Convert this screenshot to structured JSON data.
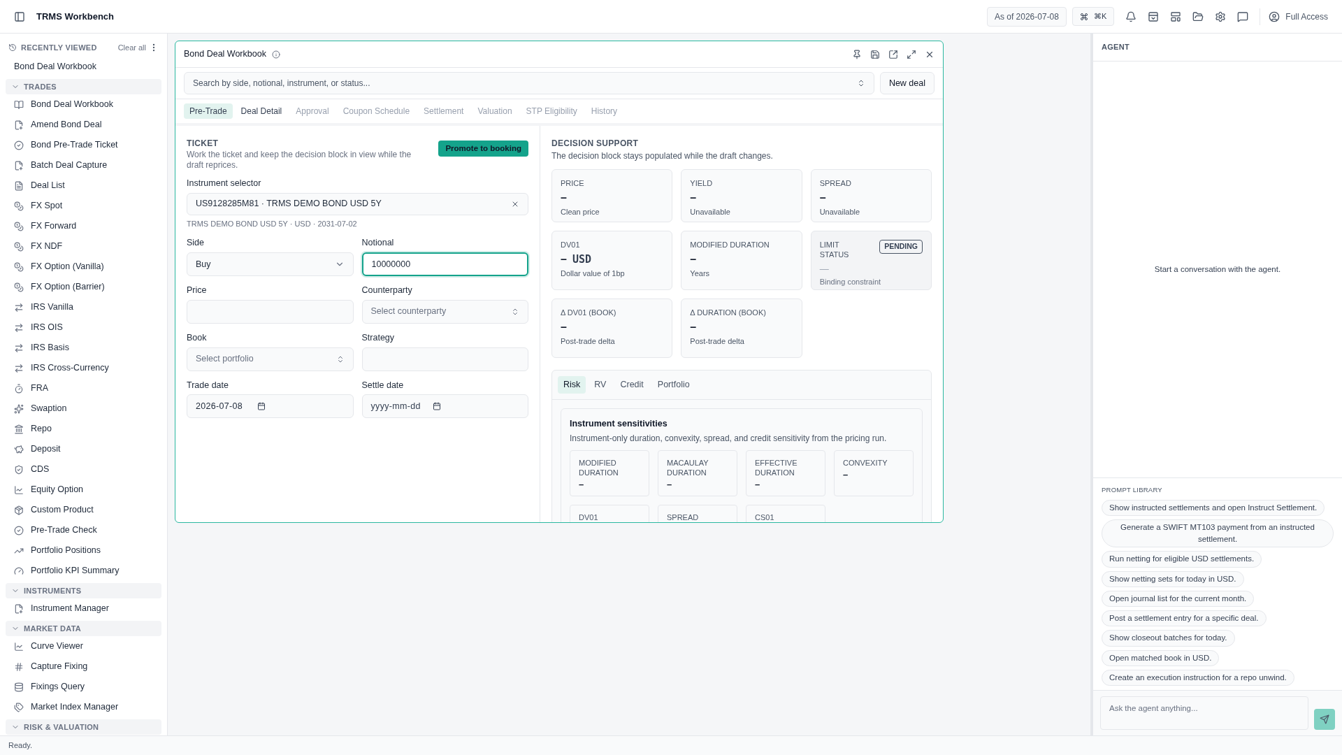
{
  "app": {
    "title": "TRMS Workbench",
    "as_of": "As of 2026-07-08",
    "shortcut": "⌘K",
    "access": "Full Access"
  },
  "sidebar": {
    "recent_title": "RECENTLY VIEWED",
    "clear": "Clear all",
    "recent": [
      "Bond Deal Workbook"
    ],
    "sections": [
      {
        "title": "TRADES",
        "expanded": true,
        "items": [
          "Bond Deal Workbook",
          "Amend Bond Deal",
          "Bond Pre-Trade Ticket",
          "Batch Deal Capture",
          "Deal List",
          "FX Spot",
          "FX Forward",
          "FX NDF",
          "FX Option (Vanilla)",
          "FX Option (Barrier)",
          "IRS Vanilla",
          "IRS OIS",
          "IRS Basis",
          "IRS Cross-Currency",
          "FRA",
          "Swaption",
          "Repo",
          "Deposit",
          "CDS",
          "Equity Option",
          "Custom Product",
          "Pre-Trade Check",
          "Portfolio Positions",
          "Portfolio KPI Summary"
        ]
      },
      {
        "title": "INSTRUMENTS",
        "expanded": true,
        "items": [
          "Instrument Manager"
        ]
      },
      {
        "title": "MARKET DATA",
        "expanded": true,
        "items": [
          "Curve Viewer",
          "Capture Fixing",
          "Fixings Query",
          "Market Index Manager"
        ]
      },
      {
        "title": "RISK & VALUATION",
        "expanded": true
      }
    ]
  },
  "window": {
    "title": "Bond Deal Workbook",
    "search_placeholder": "Search by side, notional, instrument, or status...",
    "new_button": "New deal",
    "tabs": [
      {
        "label": "Pre-Trade",
        "selected": true,
        "disabled": false
      },
      {
        "label": "Deal Detail",
        "selected": false,
        "disabled": false
      },
      {
        "label": "Approval",
        "selected": false,
        "disabled": true
      },
      {
        "label": "Coupon Schedule",
        "selected": false,
        "disabled": true
      },
      {
        "label": "Settlement",
        "selected": false,
        "disabled": true
      },
      {
        "label": "Valuation",
        "selected": false,
        "disabled": true
      },
      {
        "label": "STP Eligibility",
        "selected": false,
        "disabled": true
      },
      {
        "label": "History",
        "selected": false,
        "disabled": true
      }
    ]
  },
  "ticket": {
    "title": "TICKET",
    "description": "Work the ticket and keep the decision block in view while the draft reprices.",
    "promote_button": "Promote to booking",
    "instrument_label": "Instrument selector",
    "instrument_value": "US9128285M81 · TRMS DEMO BOND USD 5Y",
    "instrument_detail": "TRMS DEMO BOND USD 5Y · USD · 2031-07-02",
    "fields": [
      {
        "label": "Side",
        "kind": "select",
        "value": "Buy",
        "focused": false
      },
      {
        "label": "Notional",
        "kind": "input",
        "value": "10000000",
        "focused": true
      },
      {
        "label": "Price",
        "kind": "input",
        "focused": false
      },
      {
        "label": "Counterparty",
        "kind": "combo",
        "placeholder": "Select counterparty",
        "focused": false
      },
      {
        "label": "Book",
        "kind": "combo",
        "placeholder": "Select portfolio",
        "focused": false
      },
      {
        "label": "Strategy",
        "kind": "input",
        "focused": false
      },
      {
        "label": "Trade date",
        "kind": "date",
        "value": "2026-07-08",
        "focused": false
      },
      {
        "label": "Settle date",
        "kind": "date",
        "placeholder": "yyyy-mm-dd",
        "focused": false
      }
    ]
  },
  "decision": {
    "title": "DECISION SUPPORT",
    "description": "The decision block stays populated while the draft changes.",
    "cards": [
      {
        "kind": "metric",
        "label": "PRICE",
        "value": "–",
        "note": "Clean price"
      },
      {
        "kind": "metric",
        "label": "YIELD",
        "value": "–",
        "note": "Unavailable"
      },
      {
        "kind": "metric",
        "label": "SPREAD",
        "value": "–",
        "note": "Unavailable"
      },
      {
        "kind": "metric",
        "label": "DV01",
        "value": "–",
        "unit": "USD",
        "note": "Dollar value of 1bp"
      },
      {
        "kind": "metric",
        "label": "MODIFIED DURATION",
        "value": "–",
        "note": "Years"
      },
      {
        "kind": "status",
        "label": "LIMIT STATUS",
        "badge": "PENDING",
        "value": "—",
        "note": "Binding constraint"
      },
      {
        "kind": "metric",
        "label": "Δ DV01 (BOOK)",
        "value": "–",
        "note": "Post-trade delta"
      },
      {
        "kind": "metric",
        "label": "Δ DURATION (BOOK)",
        "value": "–",
        "note": "Post-trade delta"
      }
    ],
    "tabs": [
      {
        "label": "Risk",
        "selected": true
      },
      {
        "label": "RV",
        "selected": false
      },
      {
        "label": "Credit",
        "selected": false
      },
      {
        "label": "Portfolio",
        "selected": false
      }
    ],
    "panel": {
      "title": "Instrument sensitivities",
      "description": "Instrument-only duration, convexity, spread, and credit sensitivity from the pricing run.",
      "cards": [
        {
          "label": "MODIFIED DURATION",
          "value": "–"
        },
        {
          "label": "MACAULAY DURATION",
          "value": "–"
        },
        {
          "label": "EFFECTIVE DURATION",
          "value": "–"
        },
        {
          "label": "CONVEXITY",
          "value": "–"
        },
        {
          "label": "DV01"
        },
        {
          "label": "SPREAD"
        },
        {
          "label": "CS01"
        }
      ]
    }
  },
  "agent": {
    "title": "AGENT",
    "empty": "Start a conversation with the agent.",
    "library_title": "PROMPT LIBRARY",
    "prompts": [
      "Show instructed settlements and open Instruct Settlement.",
      "Generate a SWIFT MT103 payment from an instructed settlement.",
      "Run netting for eligible USD settlements.",
      "Show netting sets for today in USD.",
      "Open journal list for the current month.",
      "Post a settlement entry for a specific deal.",
      "Show closeout batches for today.",
      "Open matched book in USD.",
      "Create an execution instruction for a repo unwind."
    ],
    "input_placeholder": "Ask the agent anything..."
  },
  "status_bar": "Ready."
}
